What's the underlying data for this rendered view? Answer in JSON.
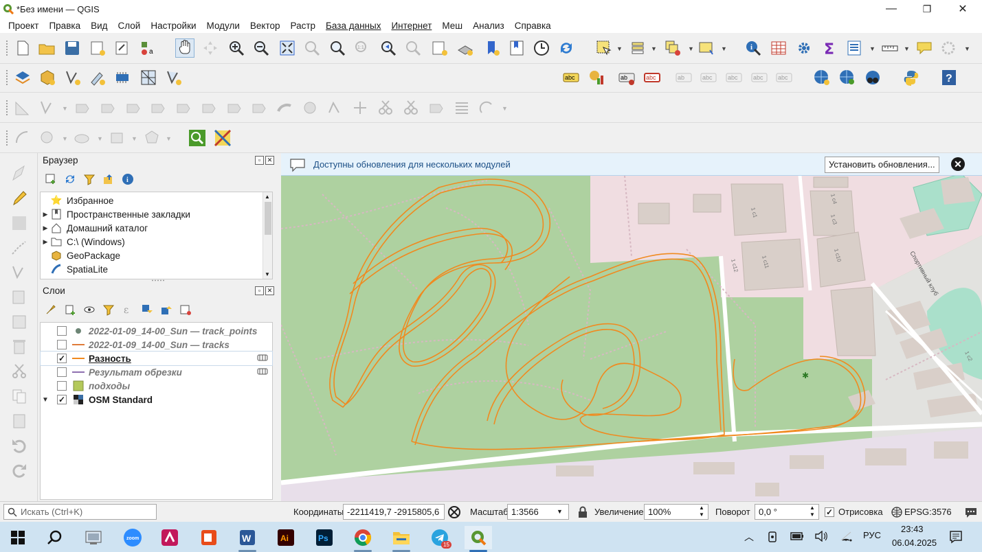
{
  "window": {
    "title": "*Без имени — QGIS",
    "minimize_glyph": "—",
    "maximize_glyph": "❐",
    "close_glyph": "✕"
  },
  "menu": [
    "Проект",
    "Правка",
    "Вид",
    "Слой",
    "Настройки",
    "Модули",
    "Вектор",
    "Растр",
    "База данных",
    "Интернет",
    "Меш",
    "Анализ",
    "Справка"
  ],
  "browser_panel": {
    "title": "Браузер",
    "items": [
      {
        "label": "Избранное",
        "icon": "star-icon",
        "expandable": false
      },
      {
        "label": "Пространственные закладки",
        "icon": "bookmark-icon",
        "expandable": true
      },
      {
        "label": "Домашний каталог",
        "icon": "home-folder-icon",
        "expandable": true
      },
      {
        "label": "C:\\ (Windows)",
        "icon": "folder-icon",
        "expandable": true
      },
      {
        "label": "GeoPackage",
        "icon": "geopackage-icon",
        "expandable": false
      },
      {
        "label": "SpatiaLite",
        "icon": "spatialite-icon",
        "expandable": false
      }
    ]
  },
  "layers_panel": {
    "title": "Слои",
    "layers": [
      {
        "label": "2022-01-09_14-00_Sun — track_points",
        "checked": false,
        "style": "italic-grey",
        "symbol": "point"
      },
      {
        "label": "2022-01-09_14-00_Sun — tracks",
        "checked": false,
        "style": "italic-grey",
        "symbol": "line-orange"
      },
      {
        "label": "Разность",
        "checked": true,
        "style": "bold-underline",
        "symbol": "line-orange"
      },
      {
        "label": "Результат обрезки",
        "checked": false,
        "style": "italic-grey",
        "symbol": "line-purple"
      },
      {
        "label": "подходы",
        "checked": false,
        "style": "italic-grey",
        "symbol": "fill-green"
      },
      {
        "label": "OSM Standard",
        "checked": true,
        "style": "bold",
        "symbol": "raster"
      }
    ]
  },
  "message_bar": {
    "text": "Доступны обновления для нескольких модулей",
    "button": "Установить обновления...",
    "close_glyph": "✕"
  },
  "map": {
    "colors": {
      "forest": "#aed1a0",
      "industrial": "#f0dde1",
      "residential": "#e4e4e4",
      "pitch": "#aae0cb",
      "track": "#f08a1f",
      "building": "#d9cfc9"
    },
    "labels": [
      "1 с1",
      "1 с2",
      "1 с3",
      "1 с4",
      "1 с10",
      "1 с11",
      "1 с12",
      "Спортивный клуб"
    ]
  },
  "statusbar": {
    "search_placeholder": "Искать (Ctrl+K)",
    "coord_label": "Координаты",
    "coord_value": "-2211419,7  -2915805,6",
    "scale_label": "Масштаб",
    "scale_value": "1:3566",
    "magnifier_label": "Увеличение",
    "magnifier_value": "100%",
    "rotation_label": "Поворот",
    "rotation_value": "0,0 °",
    "render_label": "Отрисовка",
    "render_checked": true,
    "crs": "EPSG:3576"
  },
  "taskbar": {
    "time": "23:43",
    "date": "06.04.2025",
    "lang": "РУС",
    "telegram_badge": "15",
    "apps": [
      "windows-start-icon",
      "search-icon",
      "file-manager-icon",
      "zoom-icon",
      "teams-icon",
      "ms-office-icon",
      "word-icon",
      "illustrator-icon",
      "photoshop-icon",
      "chrome-icon",
      "explorer-icon",
      "telegram-icon",
      "qgis-icon"
    ]
  }
}
